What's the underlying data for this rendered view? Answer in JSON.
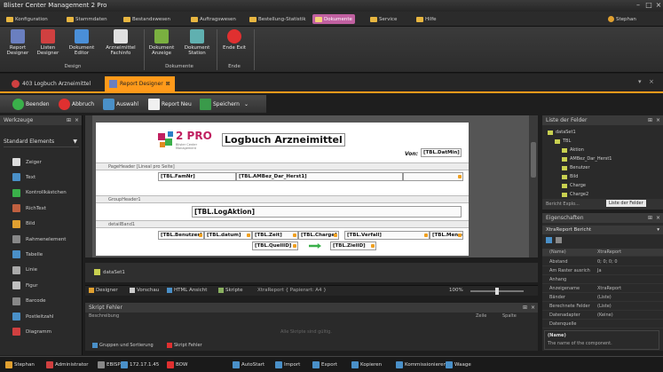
{
  "window": {
    "title": "Blister Center Management 2 Pro"
  },
  "menu": [
    "Konfiguration",
    "Stammdaten",
    "Bestandswesen",
    "Auftragswesen",
    "Bestellung-Statistik",
    "Dokumente",
    "Service",
    "Hilfe"
  ],
  "menu_active": "Dokumente",
  "user": "Stephan",
  "ribbon": {
    "buttons": [
      {
        "label1": "Report",
        "label2": "Designer",
        "icon": "report-designer-icon",
        "color": "#6a7fc0"
      },
      {
        "label1": "Listen",
        "label2": "Designer",
        "icon": "list-designer-icon",
        "color": "#d04040"
      },
      {
        "label1": "Dokument",
        "label2": "Editor",
        "icon": "document-editor-icon",
        "color": "#4a8fd8"
      },
      {
        "label1": "Arzneimittel",
        "label2": "Fachinfo",
        "icon": "fachinfo-icon",
        "color": "#e0e0e0"
      },
      {
        "label1": "Dokument",
        "label2": "Anzeige",
        "icon": "document-view-icon",
        "color": "#7ab040"
      },
      {
        "label1": "Dokument",
        "label2": "Station",
        "icon": "document-station-icon",
        "color": "#60b0b0"
      },
      {
        "label1": "Ende Exit",
        "label2": "",
        "icon": "exit-icon",
        "color": "#e03030"
      }
    ],
    "groups": [
      "Design",
      "Dokumente",
      "Ende"
    ]
  },
  "doc_tabs": [
    {
      "label": "403 Logbuch Arzneimittel",
      "active": false
    },
    {
      "label": "Report Designer",
      "active": true
    }
  ],
  "designer_toolbar": [
    "Beenden",
    "Abbruch",
    "Auswahl",
    "Report Neu",
    "Speichern"
  ],
  "toolbox": {
    "title": "Werkzeuge",
    "group": "Standard Elements",
    "items": [
      "Zeiger",
      "Text",
      "Kontrollkästchen",
      "RichText",
      "Bild",
      "Rahmenelement",
      "Tabelle",
      "Linie",
      "Figur",
      "Barcode",
      "Postleitzahl",
      "Diagramm"
    ]
  },
  "report": {
    "logo_text": "2 PRO",
    "logo_sub": "Blister Center Management",
    "title": "Logbuch Arzneimittel",
    "von_label": "Von:",
    "von_field": "[TBL.DatMin]",
    "band_pageheader": "PageHeader [Lineal pro Seite]",
    "band_groupheader": "GroupHeader1",
    "band_detail": "detailBand1",
    "fields_header": [
      "[TBL.FamNr]",
      "[TBL.AMBez_Dar_Herst1]"
    ],
    "field_group": "[TBL.LogAktion]",
    "fields_detail_row1": [
      "[TBL.Benutzer]",
      "[TBL.datum]",
      "[TBL.Zeit]",
      "[TBL.Charge]",
      "[TBL.Verfall]",
      "[TBL.Menge]"
    ],
    "fields_detail_row2": [
      "[TBL.QuellID]",
      "[TBL.ZielID]"
    ]
  },
  "dataset": "dataSet1",
  "view_tabs": [
    "Designer",
    "Vorschau",
    "HTML Ansicht",
    "Skripte",
    "XtraReport { Papierart: A4 }"
  ],
  "zoom": "100%",
  "script_errors": {
    "title": "Skript Fehler",
    "columns": [
      "Beschreibung",
      "Zeile",
      "Spalte"
    ],
    "empty_text": "Alle Skripte sind gültig.",
    "tabs": [
      "Gruppen und Sortierung",
      "Skript Fehler"
    ]
  },
  "field_list": {
    "title": "Liste der Felder",
    "tree": [
      "dataSet1",
      "TBL",
      "Aktion",
      "AMBez_Dar_Herst1",
      "Benutzer",
      "Bild",
      "Charge",
      "Charge2"
    ],
    "tabs": [
      "Bericht Explo...",
      "Liste der Felder"
    ]
  },
  "properties": {
    "title": "Eigenschaften",
    "object": "XtraReport  Bericht",
    "header": [
      "(Name)",
      "XtraReport"
    ],
    "rows": [
      [
        "Abstand",
        "0; 0; 0; 0"
      ],
      [
        "Am Raster ausrich",
        "Ja"
      ],
      [
        "Anhang",
        ""
      ],
      [
        "Anzeigename",
        "XtraReport"
      ],
      [
        "Bänder",
        "(Liste)"
      ],
      [
        "Berechnete Felder",
        "(Liste)"
      ],
      [
        "Datenadapter",
        "(Keine)"
      ],
      [
        "Datenquelle",
        ""
      ]
    ],
    "desc_title": "(Name)",
    "desc_text": "The name of the component."
  },
  "statusbar": [
    "Stephan",
    "Administrator",
    "EBISPC",
    "172.17.1.45",
    "BOW",
    "AutoStart",
    "Import",
    "Export",
    "Kopieren",
    "Kommissionieren",
    "Waage"
  ]
}
